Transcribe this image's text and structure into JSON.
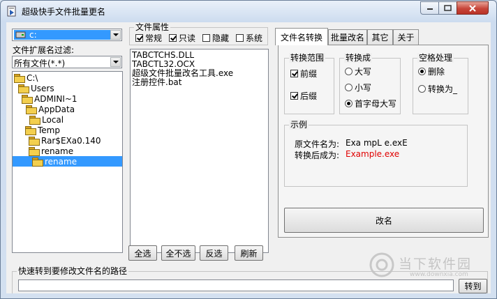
{
  "window": {
    "title": "超级快手文件批量更名",
    "minimize_icon": "minimize-icon",
    "maximize_icon": "maximize-icon",
    "close_icon": "close-icon"
  },
  "drive": {
    "value": "c:"
  },
  "filter": {
    "label": "文件扩展名过滤:",
    "value": "所有文件(*.*)"
  },
  "tree": {
    "items": [
      {
        "label": "C:\\"
      },
      {
        "label": "Users"
      },
      {
        "label": "ADMINI~1"
      },
      {
        "label": "AppData"
      },
      {
        "label": "Local"
      },
      {
        "label": "Temp"
      },
      {
        "label": "Rar$EXa0.140"
      },
      {
        "label": "rename"
      },
      {
        "label": "rename"
      }
    ]
  },
  "attributes": {
    "caption": "文件属性",
    "options": [
      {
        "label": "常规",
        "checked": true
      },
      {
        "label": "只读",
        "checked": true
      },
      {
        "label": "隐藏",
        "checked": false
      },
      {
        "label": "系统",
        "checked": false
      }
    ]
  },
  "files": [
    "TABCTCHS.DLL",
    "TABCTL32.OCX",
    "超级文件批量改名工具.exe",
    "注册控件.bat"
  ],
  "file_buttons": {
    "select_all": "全选",
    "select_none": "全不选",
    "invert": "反选",
    "refresh": "刷新"
  },
  "tabs": [
    "文件名转换",
    "批量改名",
    "其它",
    "关于"
  ],
  "scope": {
    "caption": "转换范围",
    "prefix": "前缀",
    "suffix": "后缀"
  },
  "convert": {
    "caption": "转换成",
    "upper": "大写",
    "lower": "小写",
    "title_case": "首字母大写"
  },
  "space": {
    "caption": "空格处理",
    "delete": "删除",
    "replace": "转换为_"
  },
  "example": {
    "caption": "示例",
    "original_label": "原文件名为:",
    "original_value": "Exa mpL e.exE",
    "converted_label": "转换后成为:",
    "converted_value": "Example.exe",
    "accent_color": "#e00000"
  },
  "rename_button": "改名",
  "quick_path": {
    "label": "快速转到要修改文件名的路径",
    "value": "",
    "go": "转到"
  },
  "watermark": {
    "brand": "当下软件园",
    "url": "www.downxia.com"
  }
}
